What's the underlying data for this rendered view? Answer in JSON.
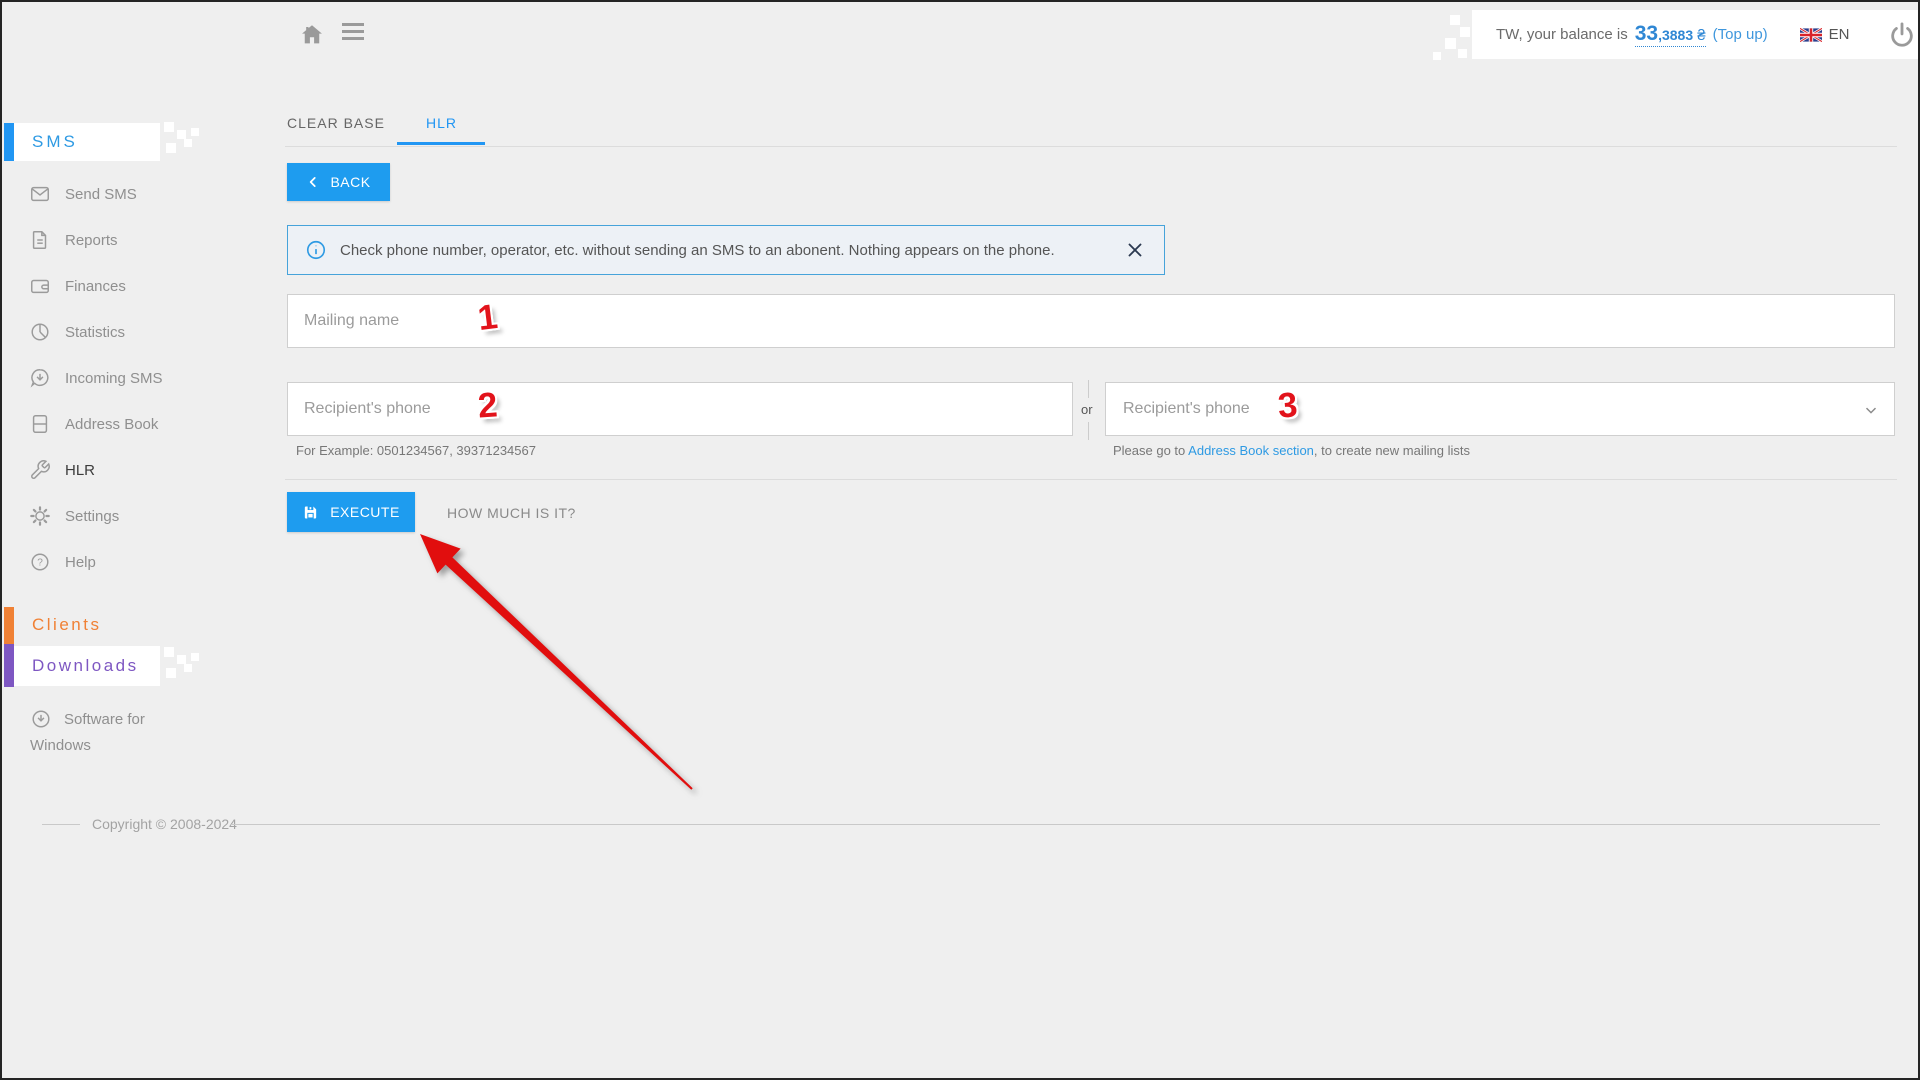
{
  "topbar": {
    "balance_prefix": "TW, your balance is",
    "balance_int": "33",
    "balance_frac": ",3883",
    "balance_currency": " ₴",
    "topup_label": "(Top up)",
    "language": "EN"
  },
  "sidebar": {
    "sms_header": "SMS",
    "items": [
      {
        "label": "Send SMS"
      },
      {
        "label": "Reports"
      },
      {
        "label": "Finances"
      },
      {
        "label": "Statistics"
      },
      {
        "label": "Incoming SMS"
      },
      {
        "label": "Address Book"
      },
      {
        "label": "HLR",
        "active": true
      },
      {
        "label": "Settings"
      },
      {
        "label": "Help"
      }
    ],
    "clients_header": "Clients",
    "downloads_header": "Downloads",
    "software_label": "Software for Windows"
  },
  "tabs": [
    {
      "label": "CLEAR BASE",
      "active": false
    },
    {
      "label": "HLR",
      "active": true
    }
  ],
  "main": {
    "back_label": "BACK",
    "banner_text": "Check phone number, operator, etc. without sending an SMS to an abonent. Nothing appears on the phone.",
    "mailing_name_placeholder": "Mailing name",
    "phone_placeholder": "Recipient's phone",
    "phone_hint": "For Example: 0501234567, 39371234567",
    "or_label": "or",
    "list_placeholder": "Recipient's phone",
    "list_hint_prefix": "Please go to ",
    "list_hint_link": "Address Book section",
    "list_hint_suffix": ", to create new mailing lists",
    "execute_label": "EXECUTE",
    "how_much_label": "HOW MUCH IS IT?",
    "annotations": {
      "one": "1",
      "two": "2",
      "three": "3"
    }
  },
  "footer": {
    "copyright": "Copyright © 2008-2024"
  },
  "colors": {
    "accent_blue": "#1e9cef",
    "link_blue": "#2e9ae3",
    "clients_orange": "#f08135",
    "downloads_purple": "#7e57c2",
    "annotation_red": "#e2131b",
    "banner_border": "#46a3da",
    "background": "#efefef"
  }
}
